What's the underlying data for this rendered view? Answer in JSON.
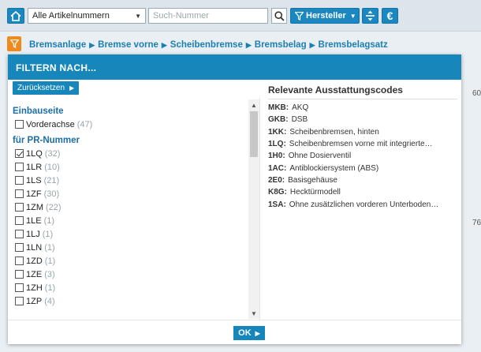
{
  "toolbar": {
    "article_select_value": "Alle Artikelnummern",
    "search_placeholder": "Such-Nummer",
    "manufacturer_label": "Hersteller",
    "currency_label": "€"
  },
  "breadcrumb": [
    "Bremsanlage",
    "Bremse vorne",
    "Scheibenbremse",
    "Bremsbelag",
    "Bremsbelagsatz"
  ],
  "modal": {
    "title": "FILTERN NACH...",
    "reset_label": "Zurücksetzen",
    "groups": [
      {
        "title": "Einbauseite",
        "options": [
          {
            "label": "Vorderachse",
            "count": "(47)",
            "checked": false
          }
        ]
      },
      {
        "title": "für PR-Nummer",
        "options": [
          {
            "label": "1LQ",
            "count": "(32)",
            "checked": true
          },
          {
            "label": "1LR",
            "count": "(10)",
            "checked": false
          },
          {
            "label": "1LS",
            "count": "(21)",
            "checked": false
          },
          {
            "label": "1ZF",
            "count": "(30)",
            "checked": false
          },
          {
            "label": "1ZM",
            "count": "(22)",
            "checked": false
          },
          {
            "label": "1LE",
            "count": "(1)",
            "checked": false
          },
          {
            "label": "1LJ",
            "count": "(1)",
            "checked": false
          },
          {
            "label": "1LN",
            "count": "(1)",
            "checked": false
          },
          {
            "label": "1ZD",
            "count": "(1)",
            "checked": false
          },
          {
            "label": "1ZE",
            "count": "(3)",
            "checked": false
          },
          {
            "label": "1ZH",
            "count": "(1)",
            "checked": false
          },
          {
            "label": "1ZP",
            "count": "(4)",
            "checked": false
          }
        ]
      }
    ],
    "codes_title": "Relevante Ausstattungscodes",
    "codes": [
      {
        "code": "MKB:",
        "desc": "AKQ"
      },
      {
        "code": "GKB:",
        "desc": "DSB"
      },
      {
        "code": "1KK:",
        "desc": "Scheibenbremsen, hinten"
      },
      {
        "code": "1LQ:",
        "desc": "Scheibenbremsen vorne mit integrierte…"
      },
      {
        "code": "1H0:",
        "desc": "Ohne Dosierventil"
      },
      {
        "code": "1AC:",
        "desc": "Antiblockiersystem (ABS)"
      },
      {
        "code": "2E0:",
        "desc": "Basisgehäuse"
      },
      {
        "code": "K8G:",
        "desc": "Hecktürmodell"
      },
      {
        "code": "1SA:",
        "desc": "Ohne zusätzlichen vorderen Unterboden…"
      }
    ],
    "ok_label": "OK"
  },
  "background": {
    "edge_num_1": "60",
    "edge_num_2": "76"
  },
  "colors": {
    "accent": "#1786bb",
    "orange": "#f08a1c"
  }
}
